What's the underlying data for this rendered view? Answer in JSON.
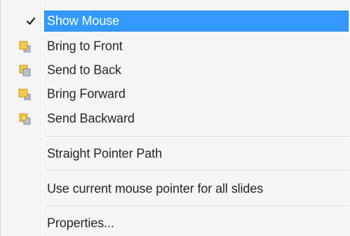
{
  "menu": {
    "items": [
      {
        "label": "Show Mouse",
        "checked": true,
        "icon": "check-icon",
        "selected": true
      },
      {
        "label": "Bring to Front",
        "icon": "bring-to-front-icon"
      },
      {
        "label": "Send to Back",
        "icon": "send-to-back-icon"
      },
      {
        "label": "Bring Forward",
        "icon": "bring-forward-icon"
      },
      {
        "label": "Send Backward",
        "icon": "send-backward-icon"
      }
    ],
    "straight_pointer_path": "Straight Pointer Path",
    "use_current_pointer": "Use current mouse pointer for all slides",
    "properties": "Properties..."
  },
  "colors": {
    "highlight": "#3399ff",
    "icon_yellow": "#f2c94c",
    "icon_gray": "#9aa3ad"
  }
}
